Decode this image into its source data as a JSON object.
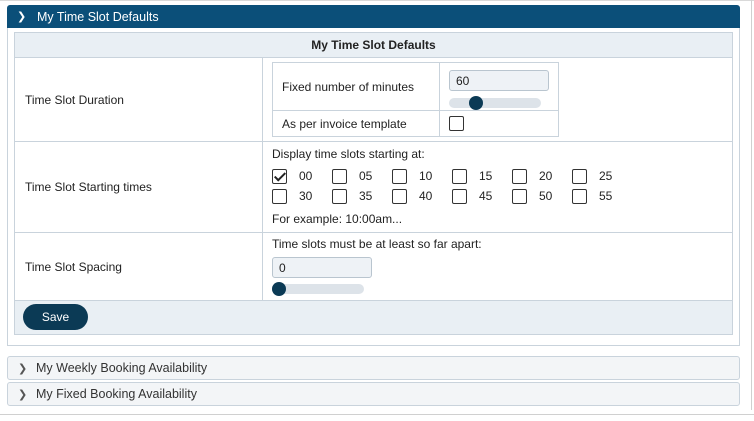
{
  "panel": {
    "title": "My Time Slot Defaults",
    "table_heading": "My Time Slot Defaults"
  },
  "duration": {
    "label": "Time Slot Duration",
    "fixed_label": "Fixed number of minutes",
    "fixed_value": "60",
    "slider_value": 60,
    "invoice_label": "As per invoice template",
    "invoice_checked": false
  },
  "starting": {
    "label": "Time Slot Starting times",
    "intro": "Display time slots starting at:",
    "options": [
      {
        "value": "00",
        "checked": true
      },
      {
        "value": "05",
        "checked": false
      },
      {
        "value": "10",
        "checked": false
      },
      {
        "value": "15",
        "checked": false
      },
      {
        "value": "20",
        "checked": false
      },
      {
        "value": "25",
        "checked": false
      },
      {
        "value": "30",
        "checked": false
      },
      {
        "value": "35",
        "checked": false
      },
      {
        "value": "40",
        "checked": false
      },
      {
        "value": "45",
        "checked": false
      },
      {
        "value": "50",
        "checked": false
      },
      {
        "value": "55",
        "checked": false
      }
    ],
    "example": "For example: 10:00am..."
  },
  "spacing": {
    "label": "Time Slot Spacing",
    "intro": "Time slots must be at least so far apart:",
    "value": "0",
    "slider_value": 0
  },
  "save_label": "Save",
  "collapsed_panels": [
    {
      "title": "My Weekly Booking Availability"
    },
    {
      "title": "My Fixed Booking Availability"
    }
  ],
  "icons": {
    "expanded": "chevron-down-icon",
    "collapsed": "chevron-right-icon"
  }
}
